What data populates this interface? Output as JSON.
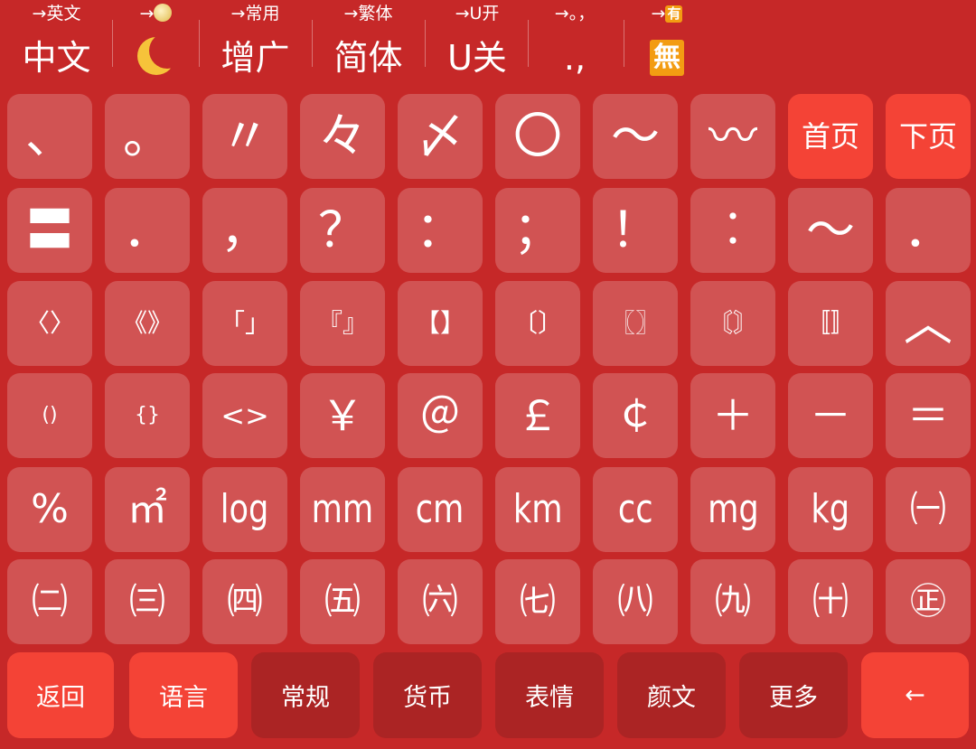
{
  "toolbar": {
    "switches": [
      {
        "name": "language",
        "hint": "→英文",
        "label": "中文"
      },
      {
        "name": "night-mode",
        "hint": "→",
        "label": ""
      },
      {
        "name": "lexicon",
        "hint": "→常用",
        "label": "增广"
      },
      {
        "name": "script",
        "hint": "→繁体",
        "label": "简体"
      },
      {
        "name": "u-mode",
        "hint": "→U开",
        "label": "U关"
      },
      {
        "name": "punctuation",
        "hint": "→。，",
        "label": ".,"
      },
      {
        "name": "emoji",
        "hint": "→",
        "label": "",
        "hint_badge": "有",
        "main_badge": "無"
      }
    ]
  },
  "keys": [
    "、",
    "。",
    "〃",
    "々",
    "〆",
    "〇",
    "〜",
    "〰",
    "首页",
    "下页",
    "〓",
    "．",
    "，",
    "？",
    "：",
    "；",
    "！",
    "︰",
    "～",
    "．",
    "〈〉",
    "《》",
    "「」",
    "『』",
    "【】",
    "〔〕",
    "〖〗",
    "〘〙",
    "〚〛",
    "︿",
    "()",
    "{}",
    "<>",
    "￥",
    "＠",
    "￡",
    "￠",
    "＋",
    "－",
    "＝",
    "%",
    "㎡",
    "log",
    "mm",
    "cm",
    "km",
    "cc",
    "mg",
    "kg",
    "㈠",
    "㈡",
    "㈢",
    "㈣",
    "㈤",
    "㈥",
    "㈦",
    "㈧",
    "㈨",
    "㈩",
    "㊣"
  ],
  "bottom_bar": {
    "back": "返回",
    "tabs": [
      "语言",
      "常规",
      "货币",
      "表情",
      "颜文",
      "更多"
    ],
    "active_tab": "语言",
    "backspace": "←"
  },
  "colors": {
    "background": "#c62828",
    "key": "rgba(255,255,255,0.2)",
    "accent": "#f44336",
    "bottom_key": "#ab2424",
    "emoji_badge": "#f39c12",
    "moon": "#f6c33a"
  }
}
